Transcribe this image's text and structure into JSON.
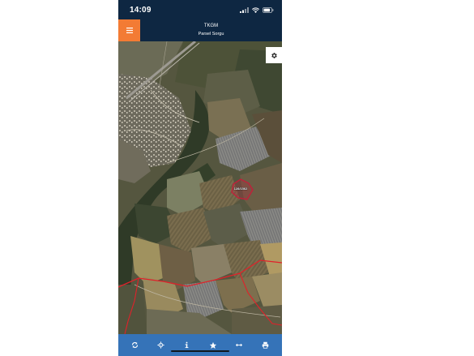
{
  "status_bar": {
    "time": "14:09",
    "icons": [
      "signal-icon",
      "wifi-icon",
      "battery-icon"
    ]
  },
  "app_bar": {
    "title": "TKGM",
    "subtitle": "Parsel Sorgu",
    "menu_icon": "hamburger-menu-icon"
  },
  "map": {
    "settings_icon": "gear-icon",
    "parcel_label": "128/1562"
  },
  "toolbar": {
    "icons": [
      "refresh-icon",
      "locate-icon",
      "info-icon",
      "star-icon",
      "measure-icon",
      "print-icon"
    ]
  },
  "colors": {
    "app_bar_bg": "#0e2742",
    "menu_button_bg": "#f37b34",
    "toolbar_bg": "#3573b8",
    "parcel_outline": "#c0203a",
    "boundary_line": "#e0212a"
  }
}
